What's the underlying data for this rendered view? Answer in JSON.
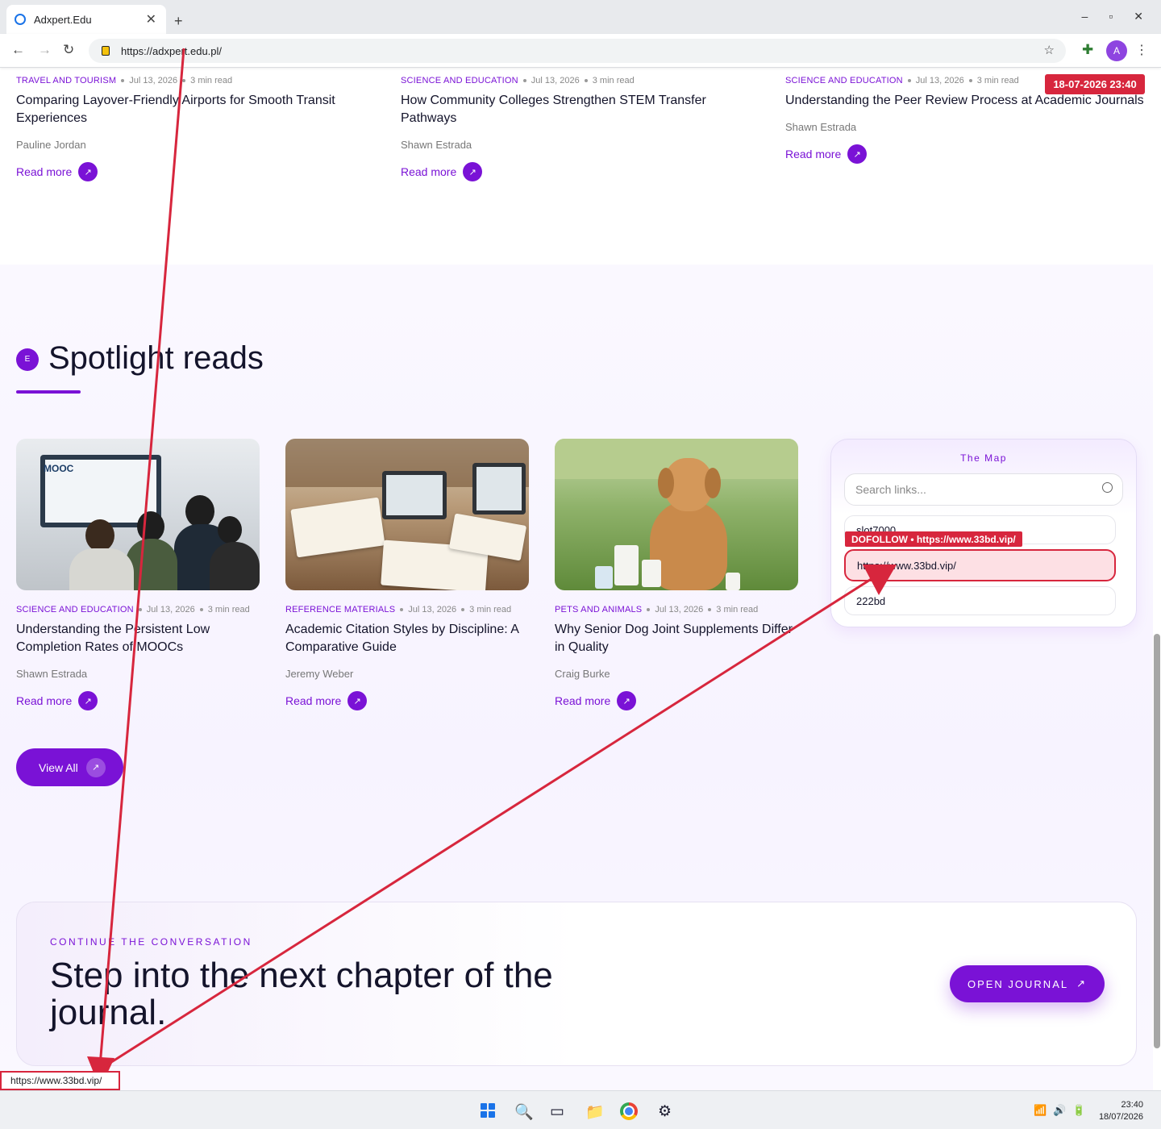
{
  "browser": {
    "tab_title": "Adxpert.Edu",
    "tab_close": "✕",
    "new_tab": "+",
    "url": "https://adxpert.edu.pl/",
    "back": "←",
    "forward": "→",
    "reload": "↻",
    "star": "☆",
    "avatar_letter": "A",
    "menu": "⋮",
    "window_min": "–",
    "window_max": "▫",
    "window_close": "✕"
  },
  "top_articles": [
    {
      "category": "TRAVEL AND TOURISM",
      "date": "Jul 13, 2026",
      "read": "3 min read",
      "title": "Comparing Layover-Friendly Airports for Smooth Transit Experiences",
      "author": "Pauline Jordan",
      "cta": "Read more"
    },
    {
      "category": "SCIENCE AND EDUCATION",
      "date": "Jul 13, 2026",
      "read": "3 min read",
      "title": "How Community Colleges Strengthen STEM Transfer Pathways",
      "author": "Shawn Estrada",
      "cta": "Read more"
    },
    {
      "category": "SCIENCE AND EDUCATION",
      "date": "Jul 13, 2026",
      "read": "3 min read",
      "title": "Understanding the Peer Review Process at Academic Journals",
      "author": "Shawn Estrada",
      "cta": "Read more"
    }
  ],
  "spotlight": {
    "badge": "E",
    "title": "Spotlight reads",
    "cards": [
      {
        "category": "SCIENCE AND EDUCATION",
        "date": "Jul 13, 2026",
        "read": "3 min read",
        "title": "Understanding the Persistent Low Completion Rates of MOOCs",
        "author": "Shawn Estrada",
        "cta": "Read more",
        "image_text": "MOOC"
      },
      {
        "category": "REFERENCE MATERIALS",
        "date": "Jul 13, 2026",
        "read": "3 min read",
        "title": "Academic Citation Styles by Discipline: A Comparative Guide",
        "author": "Jeremy Weber",
        "cta": "Read more"
      },
      {
        "category": "PETS AND ANIMALS",
        "date": "Jul 13, 2026",
        "read": "3 min read",
        "title": "Why Senior Dog Joint Supplements Differ in Quality",
        "author": "Craig Burke",
        "cta": "Read more"
      }
    ],
    "view_all": "View All"
  },
  "map": {
    "title": "The Map",
    "search_placeholder": "Search links...",
    "links": [
      "slot7000",
      "https://www.33bd.vip/",
      "222bd"
    ]
  },
  "cta": {
    "eyebrow": "CONTINUE THE CONVERSATION",
    "title": "Step into the next chapter of the journal.",
    "button": "OPEN JOURNAL"
  },
  "overlays": {
    "date_stamp": "18-07-2026 23:40",
    "dofollow": "DOFOLLOW • https://www.33bd.vip/",
    "status_url": "https://www.33bd.vip/",
    "arrow_color": "#d7263d"
  },
  "taskbar": {
    "time": "23:40",
    "date": "18/07/2026"
  },
  "colors": {
    "accent": "#7a12d6",
    "highlight": "#d7263d"
  }
}
